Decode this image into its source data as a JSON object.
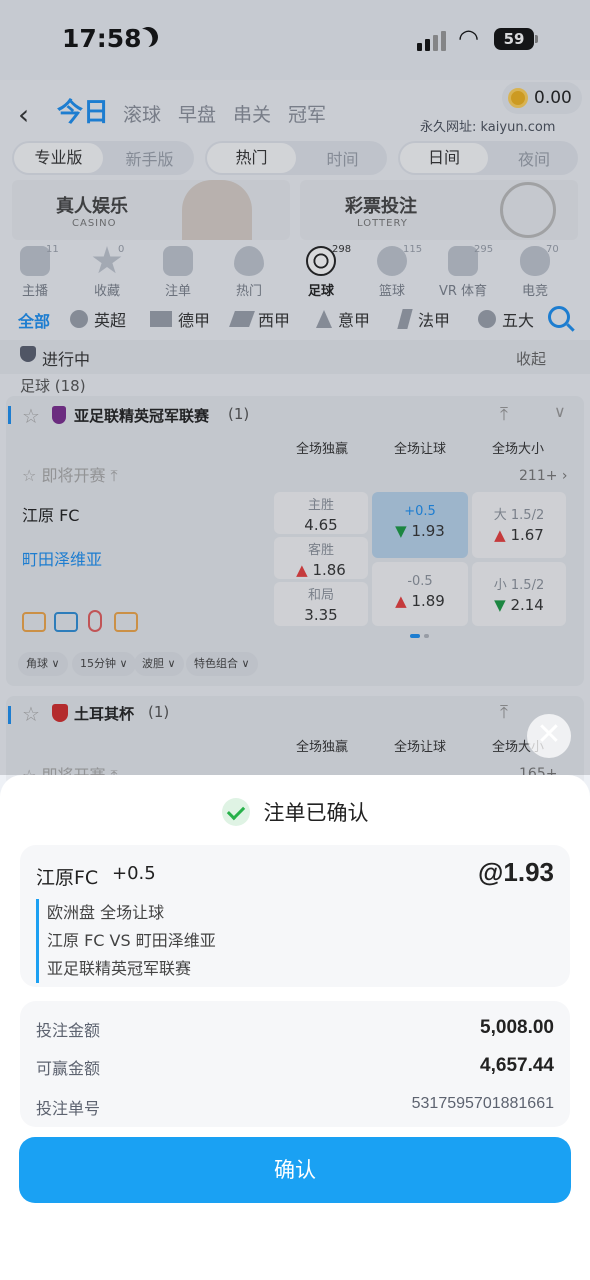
{
  "status": {
    "time": "17:58",
    "battery": "59"
  },
  "header": {
    "tabs": [
      {
        "label": "今日",
        "active": true
      },
      {
        "label": "滚球"
      },
      {
        "label": "早盘"
      },
      {
        "label": "串关"
      },
      {
        "label": "冠军"
      }
    ],
    "balance": "0.00",
    "url_label": "永久网址: kaiyun.com"
  },
  "segments": {
    "mode": [
      "专业版",
      "新手版"
    ],
    "sort": [
      "热门",
      "时间"
    ],
    "theme": [
      "日间",
      "夜间"
    ]
  },
  "banners": [
    {
      "title": "真人娱乐",
      "sub": "CASINO"
    },
    {
      "title": "彩票投注",
      "sub": "LOTTERY"
    }
  ],
  "categories": [
    {
      "label": "主播",
      "count": "11"
    },
    {
      "label": "收藏",
      "count": "0"
    },
    {
      "label": "注单",
      "count": ""
    },
    {
      "label": "热门",
      "count": ""
    },
    {
      "label": "足球",
      "count": "298"
    },
    {
      "label": "篮球",
      "count": "115"
    },
    {
      "label": "VR 体育",
      "count": "295"
    },
    {
      "label": "电竞",
      "count": "70"
    }
  ],
  "leagues": [
    "全部",
    "英超",
    "德甲",
    "西甲",
    "意甲",
    "法甲",
    "五大"
  ],
  "inprogress": {
    "label": "进行中",
    "collapse": "收起",
    "sport": "足球 (18)"
  },
  "match1": {
    "league": "亚足联精英冠军联赛",
    "league_count": "(1)",
    "col_headers": [
      "全场独赢",
      "全场让球",
      "全场大小"
    ],
    "soon": "即将开赛",
    "more": "211+",
    "home": "江原 FC",
    "away": "町田泽维亚",
    "win": [
      {
        "k": "主胜",
        "v": "4.65"
      },
      {
        "k": "客胜",
        "v": "1.86"
      },
      {
        "k": "和局",
        "v": "3.35"
      }
    ],
    "hcp": [
      {
        "k": "+0.5",
        "v": "1.93"
      },
      {
        "k": "-0.5",
        "v": "1.89"
      }
    ],
    "ou": [
      {
        "k": "大 1.5/2",
        "v": "1.67"
      },
      {
        "k": "小 1.5/2",
        "v": "2.14"
      }
    ],
    "chips": [
      "角球",
      "15分钟",
      "波胆",
      "特色组合"
    ]
  },
  "match2": {
    "league": "土耳其杯",
    "league_count": "(1)",
    "col_headers": [
      "全场独赢",
      "全场让球",
      "全场大小"
    ],
    "soon": "即将开赛",
    "more": "165+"
  },
  "sheet": {
    "title": "注单已确认",
    "selection": "江原FC",
    "handicap": "+0.5",
    "odds": "@1.93",
    "market": "欧洲盘 全场让球",
    "fixture": "江原 FC VS 町田泽维亚",
    "competition": "亚足联精英冠军联赛",
    "stake_label": "投注金额",
    "stake": "5,008.00",
    "win_label": "可赢金额",
    "win": "4,657.44",
    "id_label": "投注单号",
    "id": "5317595701881661",
    "confirm_button": "确认"
  },
  "colors": {
    "accent": "#1aa1f3",
    "up": "#e83d3d",
    "down": "#1a9a44"
  }
}
